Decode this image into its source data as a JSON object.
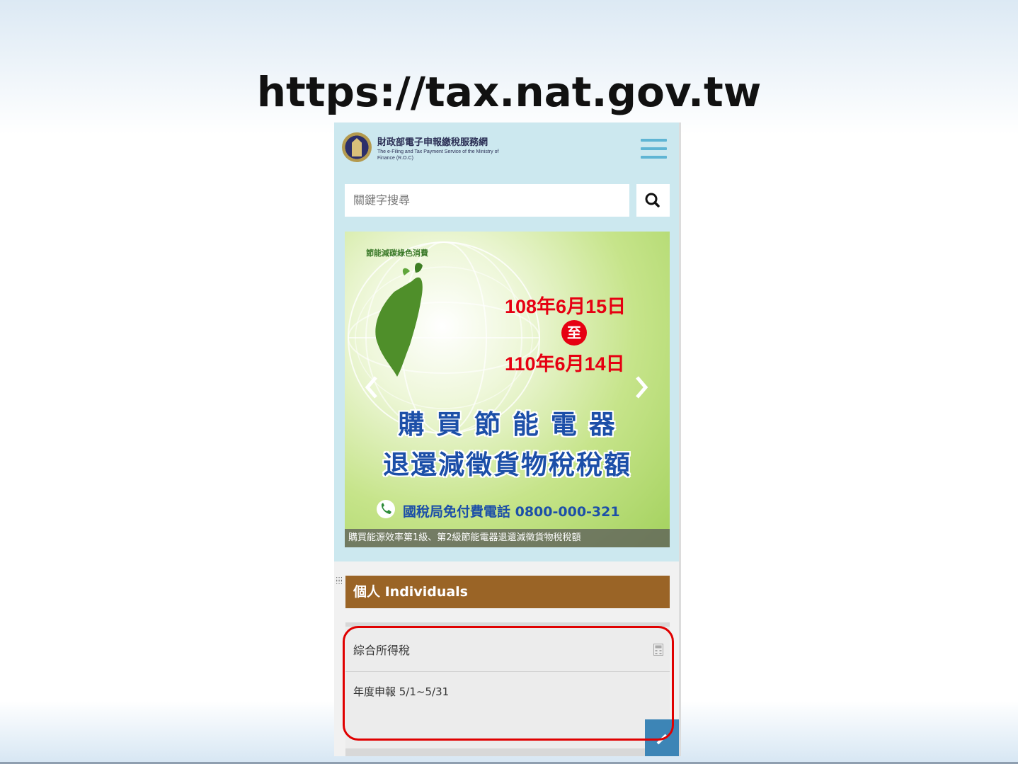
{
  "slide": {
    "url_title": "https://tax.nat.gov.tw"
  },
  "header": {
    "site_title": "財政部電子申報繳稅服務網",
    "site_subtitle": "The e-Filing and Tax Payment Service of the Ministry of Finance (R.O.C)",
    "menu_icon": "hamburger-menu-icon"
  },
  "search": {
    "placeholder": "關鍵字搜尋",
    "button_icon": "search-icon"
  },
  "banner": {
    "tag": "節能減碳綠色消費",
    "date_from": "108年6月15日",
    "to": "至",
    "date_to": "110年6月14日",
    "headline_line1": "購 買 節 能 電 器",
    "headline_line2": "退還減徵貨物稅稅額",
    "hotline": "國稅局免付費電話 0800-000-321",
    "caption": "購買能源效率第1級、第2級節能電器退還減徵貨物稅稅額",
    "prev_icon": "chevron-left-icon",
    "next_icon": "chevron-right-icon"
  },
  "section": {
    "title": "個人 Individuals"
  },
  "card": {
    "title": "綜合所得稅",
    "text": "年度申報 5/1~5/31",
    "icon": "calculator-icon"
  },
  "colors": {
    "header_bg": "#cce8ef",
    "section_header": "#9a6426",
    "highlight": "#e00000",
    "banner_red": "#e60012",
    "banner_blue": "#1c4fa8"
  }
}
